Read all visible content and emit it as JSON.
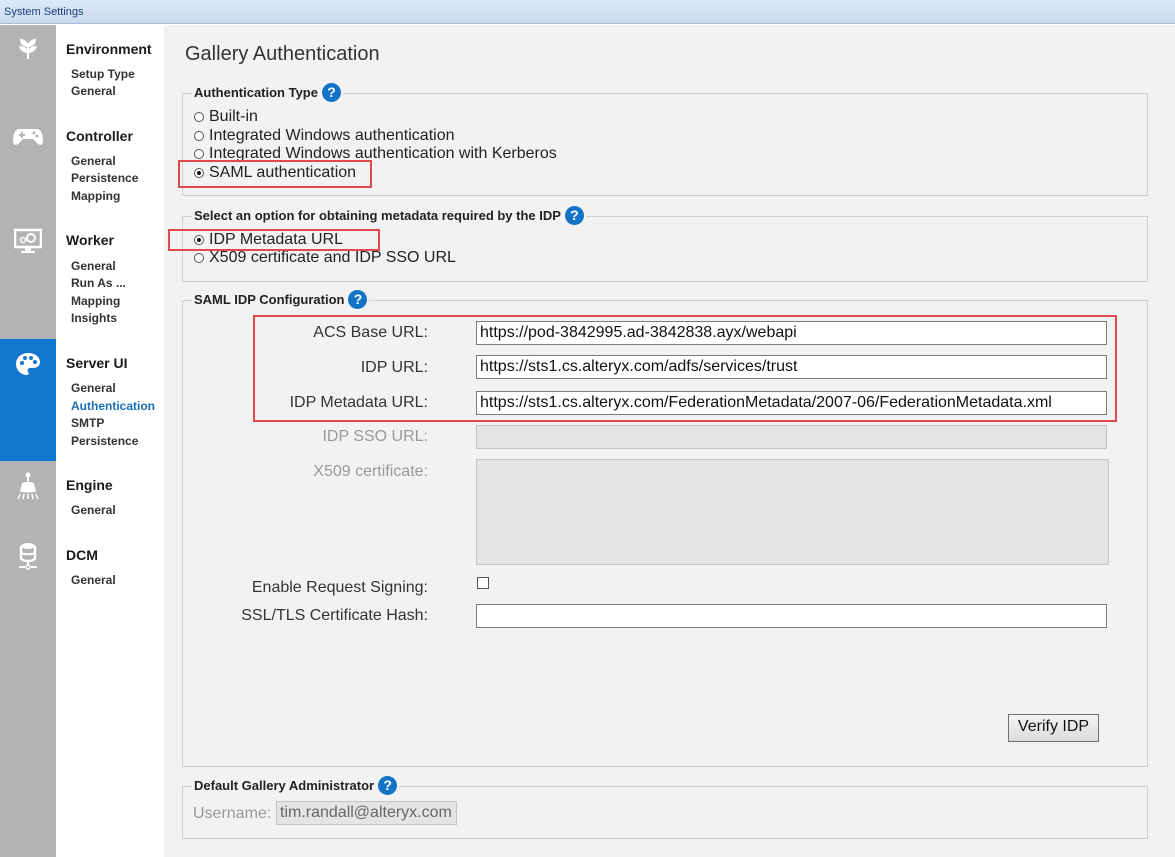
{
  "window": {
    "title": "System Settings"
  },
  "nav": {
    "sections": [
      {
        "key": "environment",
        "label": "Environment",
        "icon": "leaf-icon",
        "items": [
          "Setup Type",
          "General"
        ]
      },
      {
        "key": "controller",
        "label": "Controller",
        "icon": "gamepad-icon",
        "items": [
          "General",
          "Persistence",
          "Mapping"
        ]
      },
      {
        "key": "worker",
        "label": "Worker",
        "icon": "monitor-gear-icon",
        "items": [
          "General",
          "Run As ...",
          "Mapping",
          "Insights"
        ]
      },
      {
        "key": "server_ui",
        "label": "Server UI",
        "icon": "palette-icon",
        "items": [
          "General",
          "Authentication",
          "SMTP",
          "Persistence"
        ],
        "active_item": "Authentication"
      },
      {
        "key": "engine",
        "label": "Engine",
        "icon": "flask-icon",
        "items": [
          "General"
        ]
      },
      {
        "key": "dcm",
        "label": "DCM",
        "icon": "database-icon",
        "items": [
          "General"
        ]
      }
    ]
  },
  "page": {
    "title": "Gallery Authentication",
    "auth_type": {
      "legend": "Authentication Type",
      "options": [
        "Built-in",
        "Integrated Windows authentication",
        "Integrated Windows authentication with Kerberos",
        "SAML authentication"
      ],
      "selected": "SAML authentication"
    },
    "metadata_option": {
      "legend": "Select an option for obtaining metadata required by the IDP",
      "options": [
        "IDP Metadata URL",
        "X509 certificate and IDP SSO URL"
      ],
      "selected": "IDP Metadata URL"
    },
    "saml_config": {
      "legend": "SAML IDP Configuration",
      "acs_label": "ACS Base URL:",
      "acs_value": "https://pod-3842995.ad-3842838.ayx/webapi",
      "idp_url_label": "IDP URL:",
      "idp_url_value": "https://sts1.cs.alteryx.com/adfs/services/trust",
      "metadata_url_label": "IDP Metadata URL:",
      "metadata_url_value": "https://sts1.cs.alteryx.com/FederationMetadata/2007-06/FederationMetadata.xml",
      "sso_url_label": "IDP SSO URL:",
      "sso_url_value": "",
      "x509_label": "X509 certificate:",
      "x509_value": "",
      "request_signing_label": "Enable Request Signing:",
      "request_signing_checked": false,
      "cert_hash_label": "SSL/TLS Certificate Hash:",
      "cert_hash_value": "",
      "verify_button": "Verify IDP"
    },
    "admin": {
      "legend": "Default Gallery Administrator",
      "username_label": "Username:",
      "username_value": "tim.randall@alteryx.com"
    }
  },
  "colors": {
    "accent": "#1376cf",
    "highlight_box": "#e04a4a",
    "icon_rail": "#b3b3b3",
    "main_bg": "#f2f2f2"
  }
}
